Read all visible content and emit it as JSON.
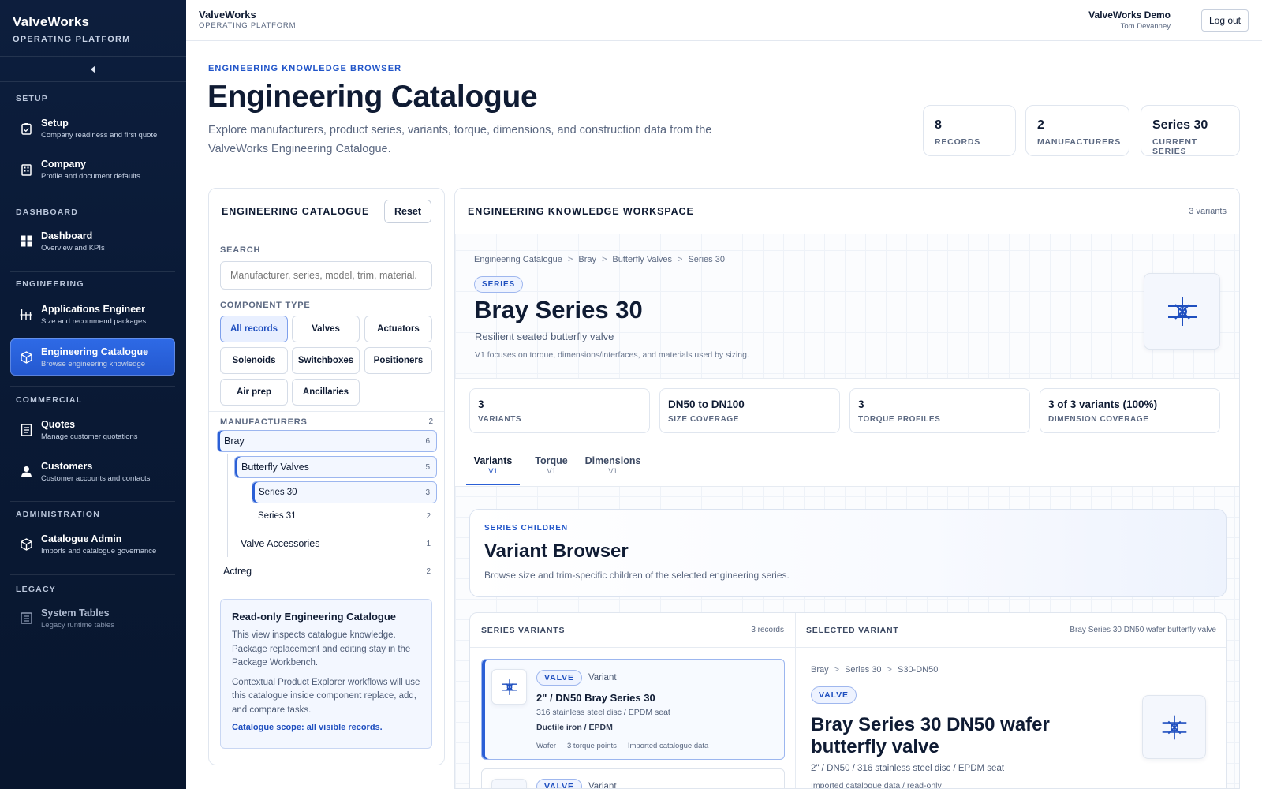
{
  "sidebar": {
    "brand_name": "ValveWorks",
    "brand_sub": "OPERATING PLATFORM",
    "sections": {
      "setup": "SETUP",
      "dashboard": "DASHBOARD",
      "engineering": "ENGINEERING",
      "commercial": "COMMERCIAL",
      "administration": "ADMINISTRATION",
      "legacy": "LEGACY"
    },
    "items": [
      {
        "label": "Setup",
        "sub": "Company readiness and first quote",
        "icon": "clipboard-icon"
      },
      {
        "label": "Company",
        "sub": "Profile and document defaults",
        "icon": "building-icon"
      },
      {
        "label": "Dashboard",
        "sub": "Overview and KPIs",
        "icon": "grid-icon"
      },
      {
        "label": "Applications Engineer",
        "sub": "Size and recommend packages",
        "icon": "sliders-icon"
      },
      {
        "label": "Engineering Catalogue",
        "sub": "Browse engineering knowledge",
        "icon": "cube-icon"
      },
      {
        "label": "Quotes",
        "sub": "Manage customer quotations",
        "icon": "document-icon"
      },
      {
        "label": "Customers",
        "sub": "Customer accounts and contacts",
        "icon": "user-icon"
      },
      {
        "label": "Catalogue Admin",
        "sub": "Imports and catalogue governance",
        "icon": "cube-icon"
      },
      {
        "label": "System Tables",
        "sub": "Legacy runtime tables",
        "icon": "table-icon"
      }
    ],
    "active_item": "Engineering Catalogue"
  },
  "topbar": {
    "brand_name": "ValveWorks",
    "brand_sub": "OPERATING PLATFORM",
    "account_name": "ValveWorks Demo",
    "user_name": "Tom Devanney",
    "logout_label": "Log out"
  },
  "header": {
    "eyebrow": "ENGINEERING KNOWLEDGE BROWSER",
    "title": "Engineering Catalogue",
    "description": "Explore manufacturers, product series, variants, torque, dimensions, and construction data from the ValveWorks Engineering Catalogue.",
    "stats": [
      {
        "value": "8",
        "label": "RECORDS"
      },
      {
        "value": "2",
        "label": "MANUFACTURERS"
      },
      {
        "value": "Series 30",
        "label": "CURRENT SERIES"
      }
    ]
  },
  "catalogue_panel": {
    "title": "ENGINEERING CATALOGUE",
    "reset_label": "Reset",
    "search_label": "SEARCH",
    "search_placeholder": "Manufacturer, series, model, trim, material.",
    "component_type_label": "COMPONENT TYPE",
    "component_types": [
      "All records",
      "Valves",
      "Actuators",
      "Solenoids",
      "Switchboxes",
      "Positioners",
      "Air prep",
      "Ancillaries"
    ],
    "selected_component_type": "All records",
    "manufacturers_label": "MANUFACTURERS",
    "manufacturers_count": "2",
    "tree": {
      "bray": {
        "label": "Bray",
        "count": "6"
      },
      "butterfly": {
        "label": "Butterfly Valves",
        "count": "5"
      },
      "series30": {
        "label": "Series 30",
        "count": "3"
      },
      "series31": {
        "label": "Series 31",
        "count": "2"
      },
      "accessories": {
        "label": "Valve Accessories",
        "count": "1"
      },
      "actreg": {
        "label": "Actreg",
        "count": "2"
      }
    },
    "note": {
      "title": "Read-only Engineering Catalogue",
      "p1": "This view inspects catalogue knowledge. Package replacement and editing stay in the Package Workbench.",
      "p2": "Contextual Product Explorer workflows will use this catalogue inside component replace, add, and compare tasks.",
      "scope": "Catalogue scope: all visible records."
    }
  },
  "workspace": {
    "title": "ENGINEERING KNOWLEDGE WORKSPACE",
    "count": "3 variants",
    "breadcrumb": [
      "Engineering Catalogue",
      "Bray",
      "Butterfly Valves",
      "Series 30"
    ],
    "badge": "SERIES",
    "series_title": "Bray Series 30",
    "series_subtitle": "Resilient seated butterfly valve",
    "series_note": "V1 focuses on torque, dimensions/interfaces, and materials used by sizing.",
    "metrics": [
      {
        "value": "3",
        "label": "VARIANTS"
      },
      {
        "value": "DN50 to DN100",
        "label": "SIZE COVERAGE"
      },
      {
        "value": "3",
        "label": "TORQUE PROFILES"
      },
      {
        "value": "3 of 3 variants (100%)",
        "label": "DIMENSION COVERAGE"
      }
    ],
    "tabs": [
      {
        "label": "Variants",
        "sub": "V1"
      },
      {
        "label": "Torque",
        "sub": "V1"
      },
      {
        "label": "Dimensions",
        "sub": "V1"
      }
    ],
    "active_tab": "Variants",
    "variant_browser": {
      "eyebrow": "SERIES CHILDREN",
      "title": "Variant Browser",
      "description": "Browse size and trim-specific children of the selected engineering series."
    },
    "series_variants": {
      "title": "SERIES VARIANTS",
      "count": "3 records",
      "items": [
        {
          "tag": "VALVE",
          "kind": "Variant",
          "title": "2\" / DN50 Bray Series 30",
          "spec": "316 stainless steel disc / EPDM seat",
          "material": "Ductile iron / EPDM",
          "meta": [
            "Wafer",
            "3 torque points",
            "Imported catalogue data"
          ]
        },
        {
          "tag": "VALVE",
          "kind": "Variant"
        }
      ]
    },
    "selected_variant": {
      "title": "SELECTED VARIANT",
      "name_right": "Bray Series 30 DN50 wafer butterfly valve",
      "breadcrumb": [
        "Bray",
        "Series 30",
        "S30-DN50"
      ],
      "tag": "VALVE",
      "heading": "Bray Series 30 DN50 wafer butterfly valve",
      "spec": "2\" / DN50 / 316 stainless steel disc / EPDM seat",
      "source": "Imported catalogue data / read-only"
    }
  },
  "colors": {
    "sidebar_bg": "#0b1b38",
    "accent": "#2a5fd6",
    "active_item": "#2e6ae6",
    "text_primary": "#0f1b33"
  }
}
